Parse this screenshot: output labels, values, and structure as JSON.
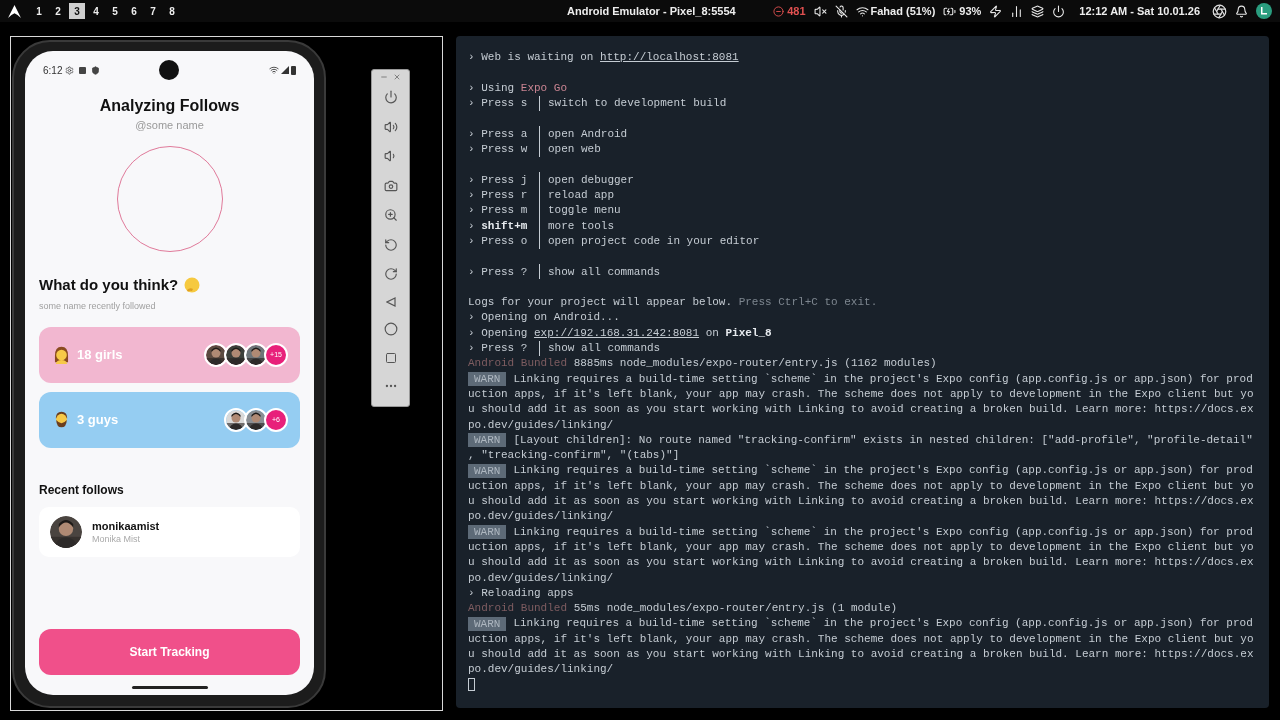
{
  "top_bar": {
    "workspaces": [
      {
        "label": "1",
        "selected": false
      },
      {
        "label": "2",
        "selected": false
      },
      {
        "label": "3",
        "selected": true
      },
      {
        "label": "4",
        "selected": false
      },
      {
        "label": "5",
        "selected": false
      },
      {
        "label": "6",
        "selected": false
      },
      {
        "label": "7",
        "selected": false
      },
      {
        "label": "8",
        "selected": false
      }
    ],
    "title": "Android Emulator - Pixel_8:5554",
    "notifications": "481",
    "wifi": "Fahad (51%)",
    "battery": "93%",
    "clock": "12:12 AM - Sat 10.01.26"
  },
  "phone": {
    "time": "6:12",
    "title": "Analyzing Follows",
    "handle": "@some name",
    "question": "What do you think?",
    "subtitle": "some name recently followed",
    "groups": [
      {
        "label": "18 girls",
        "kind": "woman",
        "color": "#f2b7d0",
        "extra": "+15"
      },
      {
        "label": "3 guys",
        "kind": "man",
        "color": "#95cdf2",
        "extra": "+6"
      }
    ],
    "recent_title": "Recent follows",
    "recent": [
      {
        "username": "monikaamist",
        "name": "Monika Mist"
      }
    ],
    "button": "Start Tracking"
  },
  "terminal": {
    "lines": [
      {
        "kind": "text",
        "segments": [
          {
            "text": "› Web is waiting on ",
            "kind": "plain"
          },
          {
            "text": "http://localhost:8081",
            "kind": "link"
          }
        ]
      },
      {
        "kind": "blank"
      },
      {
        "kind": "text",
        "segments": [
          {
            "text": "› Using ",
            "kind": "plain"
          },
          {
            "text": "Expo Go",
            "kind": "accent"
          }
        ]
      },
      {
        "kind": "command",
        "segments": [
          {
            "text": "› Press s",
            "kind": "plain"
          }
        ],
        "action": "switch to development build"
      },
      {
        "kind": "blank"
      },
      {
        "kind": "command",
        "segments": [
          {
            "text": "› Press a",
            "kind": "plain"
          }
        ],
        "action": "open Android"
      },
      {
        "kind": "command",
        "segments": [
          {
            "text": "› Press w",
            "kind": "plain"
          }
        ],
        "action": "open web"
      },
      {
        "kind": "blank"
      },
      {
        "kind": "command",
        "segments": [
          {
            "text": "› Press j",
            "kind": "plain"
          }
        ],
        "action": "open debugger"
      },
      {
        "kind": "command",
        "segments": [
          {
            "text": "› Press r",
            "kind": "plain"
          }
        ],
        "action": "reload app"
      },
      {
        "kind": "command",
        "segments": [
          {
            "text": "› Press m",
            "kind": "plain"
          }
        ],
        "action": "toggle menu"
      },
      {
        "kind": "command",
        "segments": [
          {
            "text": "› ",
            "kind": "plain"
          },
          {
            "text": "shift+m",
            "kind": "bold"
          }
        ],
        "action": "more tools"
      },
      {
        "kind": "command",
        "segments": [
          {
            "text": "› Press o",
            "kind": "plain"
          }
        ],
        "action": "open project code in your editor"
      },
      {
        "kind": "blank"
      },
      {
        "kind": "command",
        "segments": [
          {
            "text": "› Press ?",
            "kind": "plain"
          }
        ],
        "action": "show all commands"
      },
      {
        "kind": "blank"
      },
      {
        "kind": "text",
        "segments": [
          {
            "text": "Logs for your project will appear below. ",
            "kind": "plain"
          },
          {
            "text": "Press Ctrl+C to exit.",
            "kind": "dim"
          }
        ]
      },
      {
        "kind": "text",
        "segments": [
          {
            "text": "› Opening on Android...",
            "kind": "plain"
          }
        ]
      },
      {
        "kind": "text",
        "segments": [
          {
            "text": "› Opening ",
            "kind": "plain"
          },
          {
            "text": "exp://192.168.31.242:8081",
            "kind": "link"
          },
          {
            "text": " on ",
            "kind": "plain"
          },
          {
            "text": "Pixel_8",
            "kind": "bold"
          }
        ]
      },
      {
        "kind": "command",
        "segments": [
          {
            "text": "› Press ?",
            "kind": "plain"
          }
        ],
        "action": "show all commands"
      },
      {
        "kind": "text",
        "segments": [
          {
            "text": "Android Bundled",
            "kind": "bundled"
          },
          {
            "text": " 8885ms node_modules/expo-router/entry.js (1162 modules)",
            "kind": "plain"
          }
        ]
      },
      {
        "kind": "warn",
        "badge": "WARN",
        "segments": [
          {
            "text": "Linking requires a build-time setting `scheme` in the project's Expo config (app.config.js or app.json) for prod",
            "kind": "plain"
          }
        ]
      },
      {
        "kind": "text",
        "segments": [
          {
            "text": "uction apps, if it's left blank, your app may crash. The scheme does not apply to development in the Expo client but yo",
            "kind": "plain"
          }
        ]
      },
      {
        "kind": "text",
        "segments": [
          {
            "text": "u should add it as soon as you start working with Linking to avoid creating a broken build. Learn more: https://docs.ex",
            "kind": "plain"
          }
        ]
      },
      {
        "kind": "text",
        "segments": [
          {
            "text": "po.dev/guides/linking/",
            "kind": "plain"
          }
        ]
      },
      {
        "kind": "warn",
        "badge": "WARN",
        "segments": [
          {
            "text": "[Layout children]: No route named \"tracking-confirm\" exists in nested children: [\"add-profile\", \"profile-detail\"",
            "kind": "plain"
          }
        ]
      },
      {
        "kind": "text",
        "segments": [
          {
            "text": ", \"treacking-confirm\", \"(tabs)\"]",
            "kind": "plain"
          }
        ]
      },
      {
        "kind": "warn",
        "badge": "WARN",
        "segments": [
          {
            "text": "Linking requires a build-time setting `scheme` in the project's Expo config (app.config.js or app.json) for prod",
            "kind": "plain"
          }
        ]
      },
      {
        "kind": "text",
        "segments": [
          {
            "text": "uction apps, if it's left blank, your app may crash. The scheme does not apply to development in the Expo client but yo",
            "kind": "plain"
          }
        ]
      },
      {
        "kind": "text",
        "segments": [
          {
            "text": "u should add it as soon as you start working with Linking to avoid creating a broken build. Learn more: https://docs.ex",
            "kind": "plain"
          }
        ]
      },
      {
        "kind": "text",
        "segments": [
          {
            "text": "po.dev/guides/linking/",
            "kind": "plain"
          }
        ]
      },
      {
        "kind": "warn",
        "badge": "WARN",
        "segments": [
          {
            "text": "Linking requires a build-time setting `scheme` in the project's Expo config (app.config.js or app.json) for prod",
            "kind": "plain"
          }
        ]
      },
      {
        "kind": "text",
        "segments": [
          {
            "text": "uction apps, if it's left blank, your app may crash. The scheme does not apply to development in the Expo client but yo",
            "kind": "plain"
          }
        ]
      },
      {
        "kind": "text",
        "segments": [
          {
            "text": "u should add it as soon as you start working with Linking to avoid creating a broken build. Learn more: https://docs.ex",
            "kind": "plain"
          }
        ]
      },
      {
        "kind": "text",
        "segments": [
          {
            "text": "po.dev/guides/linking/",
            "kind": "plain"
          }
        ]
      },
      {
        "kind": "text",
        "segments": [
          {
            "text": "› Reloading apps",
            "kind": "plain"
          }
        ]
      },
      {
        "kind": "text",
        "segments": [
          {
            "text": "Android Bundled",
            "kind": "bundled"
          },
          {
            "text": " 55ms node_modules/expo-router/entry.js (1 module)",
            "kind": "plain"
          }
        ]
      },
      {
        "kind": "warn",
        "badge": "WARN",
        "segments": [
          {
            "text": "Linking requires a build-time setting `scheme` in the project's Expo config (app.config.js or app.json) for prod",
            "kind": "plain"
          }
        ]
      },
      {
        "kind": "text",
        "segments": [
          {
            "text": "uction apps, if it's left blank, your app may crash. The scheme does not apply to development in the Expo client but yo",
            "kind": "plain"
          }
        ]
      },
      {
        "kind": "text",
        "segments": [
          {
            "text": "u should add it as soon as you start working with Linking to avoid creating a broken build. Learn more: https://docs.ex",
            "kind": "plain"
          }
        ]
      },
      {
        "kind": "text",
        "segments": [
          {
            "text": "po.dev/guides/linking/",
            "kind": "plain"
          }
        ]
      },
      {
        "kind": "cursor"
      }
    ]
  }
}
